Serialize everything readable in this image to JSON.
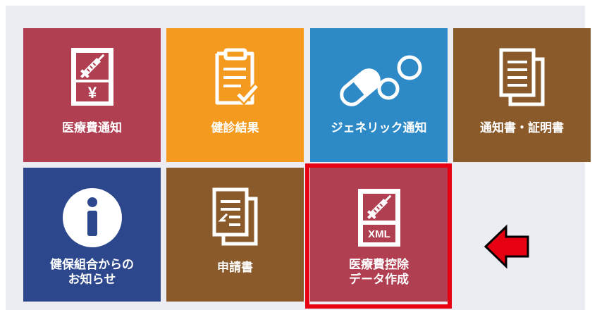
{
  "tiles": [
    {
      "id": "iryohi",
      "label": "医療費通知",
      "icon": "receipt-yen-icon",
      "color": "#b13f52"
    },
    {
      "id": "kenshin",
      "label": "健診結果",
      "icon": "clipboard-check-icon",
      "color": "#f39a1f"
    },
    {
      "id": "generic",
      "label": "ジェネリック通知",
      "icon": "pill-capsule-icon",
      "color": "#2d8ac6"
    },
    {
      "id": "tsuchi",
      "label": "通知書・証明書",
      "icon": "documents-icon",
      "color": "#8b5a2b"
    },
    {
      "id": "info",
      "label": "健保組合からの\nお知らせ",
      "icon": "info-icon",
      "color": "#2c478c"
    },
    {
      "id": "shinsei",
      "label": "申請書",
      "icon": "application-form-icon",
      "color": "#8b5a2b"
    },
    {
      "id": "xml",
      "label": "医療費控除\nデータ作成",
      "icon": "xml-document-icon",
      "color": "#b13f52",
      "icon_text": "XML",
      "yen_text": "¥"
    }
  ],
  "annotation": {
    "highlight_color": "#e60012",
    "arrow_icon": "left-arrow-icon"
  }
}
